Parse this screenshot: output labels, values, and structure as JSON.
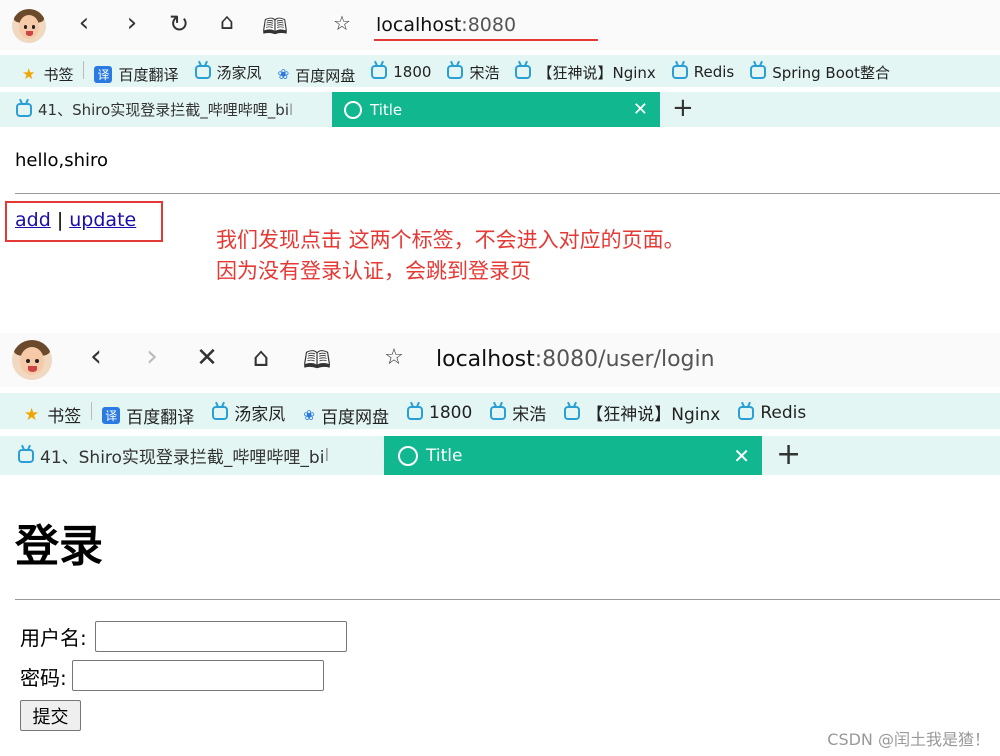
{
  "top": {
    "url_host": "localhost",
    "url_rest": ":8080",
    "bookmarks": {
      "label": "书签",
      "items": [
        "百度翻译",
        "汤家凤",
        "百度网盘",
        "1800",
        "宋浩",
        "【狂神说】Nginx",
        "Redis",
        "Spring Boot整合"
      ]
    },
    "tabs": {
      "tab1": "41、Shiro实现登录拦截_哔哩哔哩_bi",
      "tab1_fade": "l",
      "tab2": "Title"
    },
    "content": {
      "hello": "hello,shiro",
      "link_add": "add",
      "link_sep": "|",
      "link_update": "update"
    },
    "annotation": {
      "line1": "我们发现点击 这两个标签，不会进入对应的页面。",
      "line2": "因为没有登录认证，会跳到登录页"
    }
  },
  "bottom": {
    "url_host": "localhost",
    "url_rest": ":8080/user/login",
    "bookmarks": {
      "label": "书签",
      "items": [
        "百度翻译",
        "汤家凤",
        "百度网盘",
        "1800",
        "宋浩",
        "【狂神说】Nginx",
        "Redis"
      ]
    },
    "tabs": {
      "tab1": "41、Shiro实现登录拦截_哔哩哔哩_bi",
      "tab1_fade": "l",
      "tab2": "Title"
    },
    "login": {
      "heading": "登录",
      "username_label": "用户名:",
      "password_label": "密码:",
      "submit": "提交"
    }
  },
  "watermark": "CSDN @闰土我是猹！",
  "colors": {
    "tab_active": "#11b88f",
    "bar_bg": "#e3f6f3",
    "annotation": "#e53935",
    "link": "#1a0dab"
  }
}
